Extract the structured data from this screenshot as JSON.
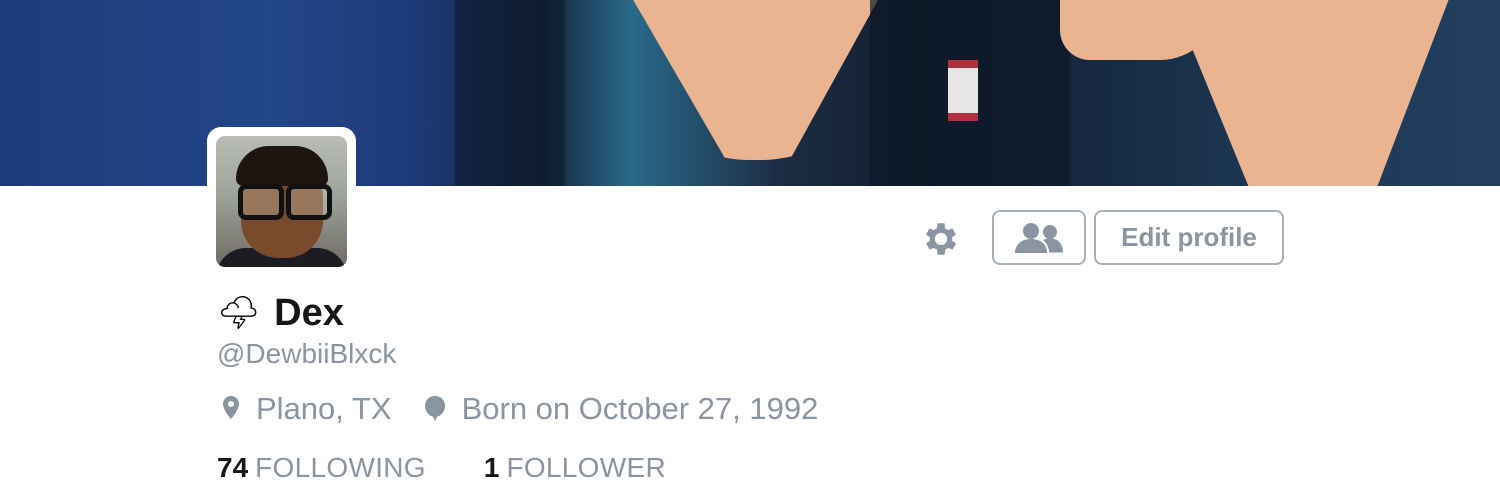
{
  "profile": {
    "name": "Dex",
    "name_emoji": "🌩",
    "handle": "@DewbiiBlxck",
    "location": "Plano, TX",
    "birthday": "Born on October 27, 1992"
  },
  "actions": {
    "settings_icon": "gear-icon",
    "people_icon": "people-icon",
    "edit_profile_label": "Edit profile"
  },
  "stats": {
    "following_count": "74",
    "following_label": "FOLLOWING",
    "followers_count": "1",
    "followers_label": "FOLLOWER"
  },
  "colors": {
    "text_primary": "#14171a",
    "text_secondary": "#8a95a1",
    "button_border": "#a7b1bb",
    "background": "#ffffff"
  }
}
